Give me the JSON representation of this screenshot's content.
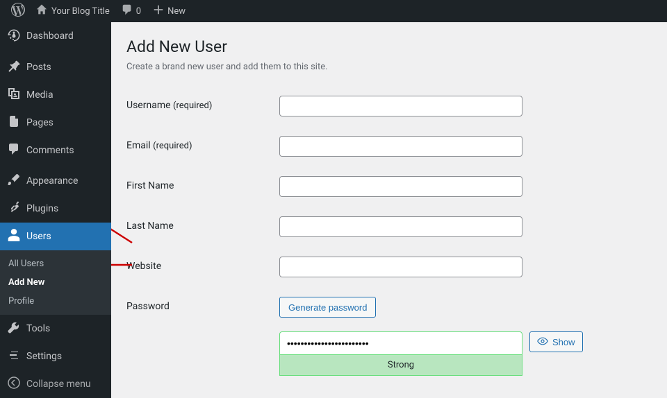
{
  "adminbar": {
    "site_title": "Your Blog Title",
    "comment_count": "0",
    "new_label": "New"
  },
  "sidebar": {
    "dashboard": "Dashboard",
    "posts": "Posts",
    "media": "Media",
    "pages": "Pages",
    "comments": "Comments",
    "appearance": "Appearance",
    "plugins": "Plugins",
    "users": "Users",
    "users_submenu": {
      "all": "All Users",
      "add": "Add New",
      "profile": "Profile"
    },
    "tools": "Tools",
    "settings": "Settings",
    "collapse": "Collapse menu"
  },
  "page": {
    "title": "Add New User",
    "subtitle": "Create a brand new user and add them to this site."
  },
  "form": {
    "username_label": "Username",
    "required": "(required)",
    "email_label": "Email",
    "firstname_label": "First Name",
    "lastname_label": "Last Name",
    "website_label": "Website",
    "password_label": "Password",
    "generate_btn": "Generate password",
    "password_value": "••••••••••••••••••••••••",
    "strength": "Strong",
    "show_btn": "Show"
  }
}
